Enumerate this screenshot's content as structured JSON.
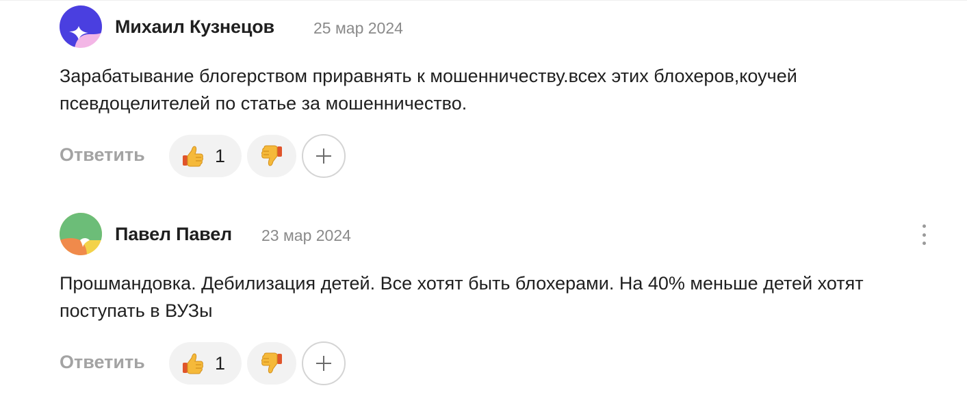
{
  "comments": [
    {
      "author": "Михаил Кузнецов",
      "date": "25 мар 2024",
      "text": "Зарабатывание блогерством приравнять к мошенничеству.всех этих блохеров,коучей псевдоцелителей по статье за мошенничество.",
      "reply_label": "Ответить",
      "likes": "1",
      "like_icon": "thumbs-up-emoji",
      "dislike_icon": "thumbs-down-emoji",
      "add_icon": "plus-icon",
      "avatar_colors": [
        "#4a3fe0",
        "#f3b6e6"
      ]
    },
    {
      "author": "Павел Павел",
      "date": "23 мар 2024",
      "text": "Прошмандовка. Дебилизация детей. Все хотят быть блохерами. На 40% меньше детей хотят поступать в ВУЗы",
      "reply_label": "Ответить",
      "likes": "1",
      "like_icon": "thumbs-up-emoji",
      "dislike_icon": "thumbs-down-emoji",
      "add_icon": "plus-icon",
      "menu_icon": "more-vertical-icon",
      "avatar_colors": [
        "#6cbd78",
        "#f08a4b",
        "#f3d24a"
      ]
    }
  ]
}
